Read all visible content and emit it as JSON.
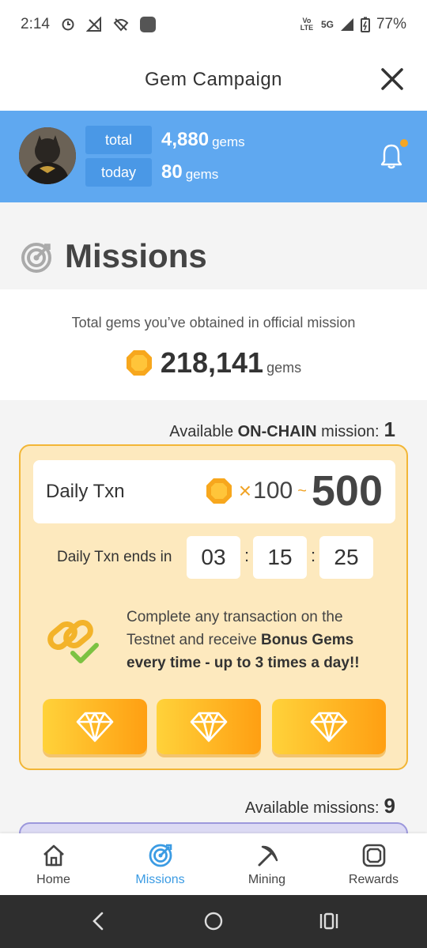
{
  "status_bar": {
    "time": "2:14",
    "network_small": "Vo LTE",
    "network_type": "5G",
    "battery": "77%"
  },
  "header": {
    "title": "Gem Campaign"
  },
  "user": {
    "total_label": "total",
    "total_value": "4,880",
    "total_unit": "gems",
    "today_label": "today",
    "today_value": "80",
    "today_unit": "gems"
  },
  "missions": {
    "title": "Missions",
    "official_caption": "Total gems you’ve obtained in official mission",
    "official_value": "218,141",
    "official_unit": "gems"
  },
  "onchain": {
    "available_prefix": "Available ",
    "available_bold": "ON-CHAIN",
    "available_suffix": " mission:",
    "available_count": "1",
    "card": {
      "name": "Daily Txn",
      "multiplier": "×",
      "reward_min": "100",
      "tilde": "~",
      "reward_max": "500",
      "timer_label": "Daily Txn ends in",
      "hours": "03",
      "minutes": "15",
      "seconds": "25",
      "separator": ":",
      "desc_plain": "Complete any transaction on the Testnet and receive ",
      "desc_bold": "Bonus Gems every time - up to 3 times a day!!"
    }
  },
  "available_missions": {
    "label": "Available missions:",
    "count": "9"
  },
  "nav": {
    "items": [
      {
        "label": "Home",
        "icon": "home-icon"
      },
      {
        "label": "Missions",
        "icon": "target-icon"
      },
      {
        "label": "Mining",
        "icon": "pickaxe-icon"
      },
      {
        "label": "Rewards",
        "icon": "gem-box-icon"
      }
    ],
    "active": "Missions"
  },
  "colors": {
    "banner": "#5fa8f0",
    "accent": "#3b9be3",
    "gold": "#f0a326",
    "card_bg": "#fde9be"
  }
}
